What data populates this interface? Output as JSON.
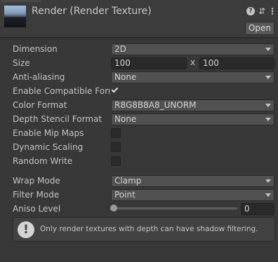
{
  "header": {
    "title": "Render (Render Texture)",
    "help_icon": "?",
    "settings_icon": "⇵",
    "menu_icon": "⋮",
    "open_label": "Open"
  },
  "fields": {
    "dimension": {
      "label": "Dimension",
      "value": "2D"
    },
    "size": {
      "label": "Size",
      "width": "100",
      "separator": "x",
      "height": "100"
    },
    "anti_aliasing": {
      "label": "Anti-aliasing",
      "value": "None"
    },
    "enable_compatible_format": {
      "label": "Enable Compatible Form",
      "checked": true
    },
    "color_format": {
      "label": "Color Format",
      "value": "R8G8B8A8_UNORM"
    },
    "depth_stencil_format": {
      "label": "Depth Stencil Format",
      "value": "None"
    },
    "enable_mip_maps": {
      "label": "Enable Mip Maps",
      "checked": false
    },
    "dynamic_scaling": {
      "label": "Dynamic Scaling",
      "checked": false
    },
    "random_write": {
      "label": "Random Write",
      "checked": false
    },
    "wrap_mode": {
      "label": "Wrap Mode",
      "value": "Clamp"
    },
    "filter_mode": {
      "label": "Filter Mode",
      "value": "Point"
    },
    "aniso_level": {
      "label": "Aniso Level",
      "value": "0",
      "slider_fraction": 0
    }
  },
  "helpbox": {
    "icon": "!",
    "text": "Only render textures with depth can have shadow filtering."
  }
}
